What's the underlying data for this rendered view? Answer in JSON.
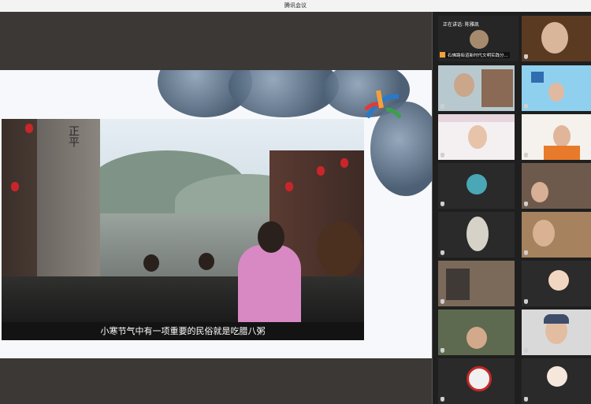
{
  "window": {
    "title": "腾讯会议"
  },
  "video": {
    "subtitle": "小寒节气中有一项重要的民俗就是吃腊八粥",
    "gate_text": "正平"
  },
  "sidebar": {
    "speaking_label": "正在讲话: 陈雅凯",
    "first_tile_name": "石佛路街道新时代文明实践分..."
  },
  "colors": {
    "accent_orange": "#f2a13a",
    "subtitle_bg": "#131313",
    "panel_bg": "#1f1f1f"
  }
}
